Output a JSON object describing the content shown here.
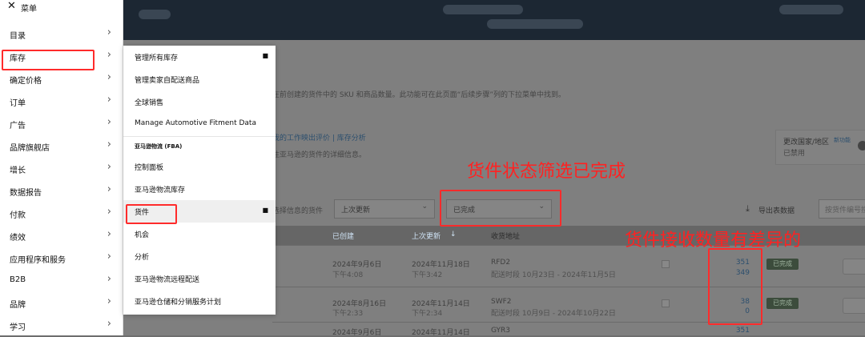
{
  "menu": {
    "title": "菜单",
    "items": [
      {
        "label": "目录"
      },
      {
        "label": "库存"
      },
      {
        "label": "确定价格"
      },
      {
        "label": "订单"
      },
      {
        "label": "广告"
      },
      {
        "label": "品牌旗舰店"
      },
      {
        "label": "增长"
      },
      {
        "label": "数据报告"
      },
      {
        "label": "付款"
      },
      {
        "label": "绩效"
      },
      {
        "label": "应用程序和服务"
      },
      {
        "label": "B2B"
      },
      {
        "label": "品牌"
      },
      {
        "label": "学习"
      }
    ]
  },
  "submenu": {
    "items": [
      {
        "label": "管理所有库存"
      },
      {
        "label": "管理卖家自配送商品"
      },
      {
        "label": "全球销售"
      },
      {
        "label": "Manage Automotive Fitment Data"
      }
    ],
    "fba_section": "亚马逊物流 (FBA)",
    "fba_items": [
      {
        "label": "控制面板"
      },
      {
        "label": "亚马逊物流库存"
      },
      {
        "label": "货件"
      },
      {
        "label": "机会"
      },
      {
        "label": "分析"
      },
      {
        "label": "亚马逊物流远程配送"
      },
      {
        "label": "亚马逊仓储和分销服务计划"
      }
    ]
  },
  "page": {
    "desc": "在前创建的货件中的 SKU 和商品数量。此功能可在此页面“后续步骤”列的下拉菜单中找到。",
    "links": "我的工作映出评价  |  库存分析",
    "desc2": "往亚马逊的货件的详细信息。",
    "region": {
      "title": "更改国家/地区",
      "tag": "新功能",
      "status": "已禁用"
    },
    "filter_label": "选择信息的货件",
    "sort_select": "上次更新",
    "status_select": "已完成",
    "export": "导出表数据",
    "search_placeholder": "按货件编号搜索"
  },
  "table": {
    "headers": [
      "已创建",
      "上次更新",
      "收货地址"
    ],
    "rows": [
      {
        "created": "2024年9月6日",
        "created_time": "下午4:08",
        "updated": "2024年11月18日",
        "updated_time": "下午3:42",
        "addr": "RFD2",
        "window": "配送时段 10月23日 - 2024年11月5日",
        "sent": "351",
        "received": "349",
        "status": "已完成"
      },
      {
        "created": "2024年8月16日",
        "created_time": "下午2:33",
        "updated": "2024年11月14日",
        "updated_time": "下午2:34",
        "addr": "SWF2",
        "window": "配送时段 10月9日 - 2024年10月22日",
        "sent": "38",
        "received": "0",
        "status": "已完成"
      },
      {
        "created": "2024年9月6日",
        "created_time": "",
        "updated": "2024年11月14日",
        "updated_time": "",
        "addr": "GYR3",
        "window": "",
        "sent": "351",
        "received": "",
        "status": ""
      }
    ]
  },
  "annotations": {
    "status_filter": "货件状态筛选已完成",
    "qty_diff": "货件接收数量有差异的"
  },
  "colors": {
    "annotation": "#ff2222",
    "link": "#2c4f6e"
  }
}
